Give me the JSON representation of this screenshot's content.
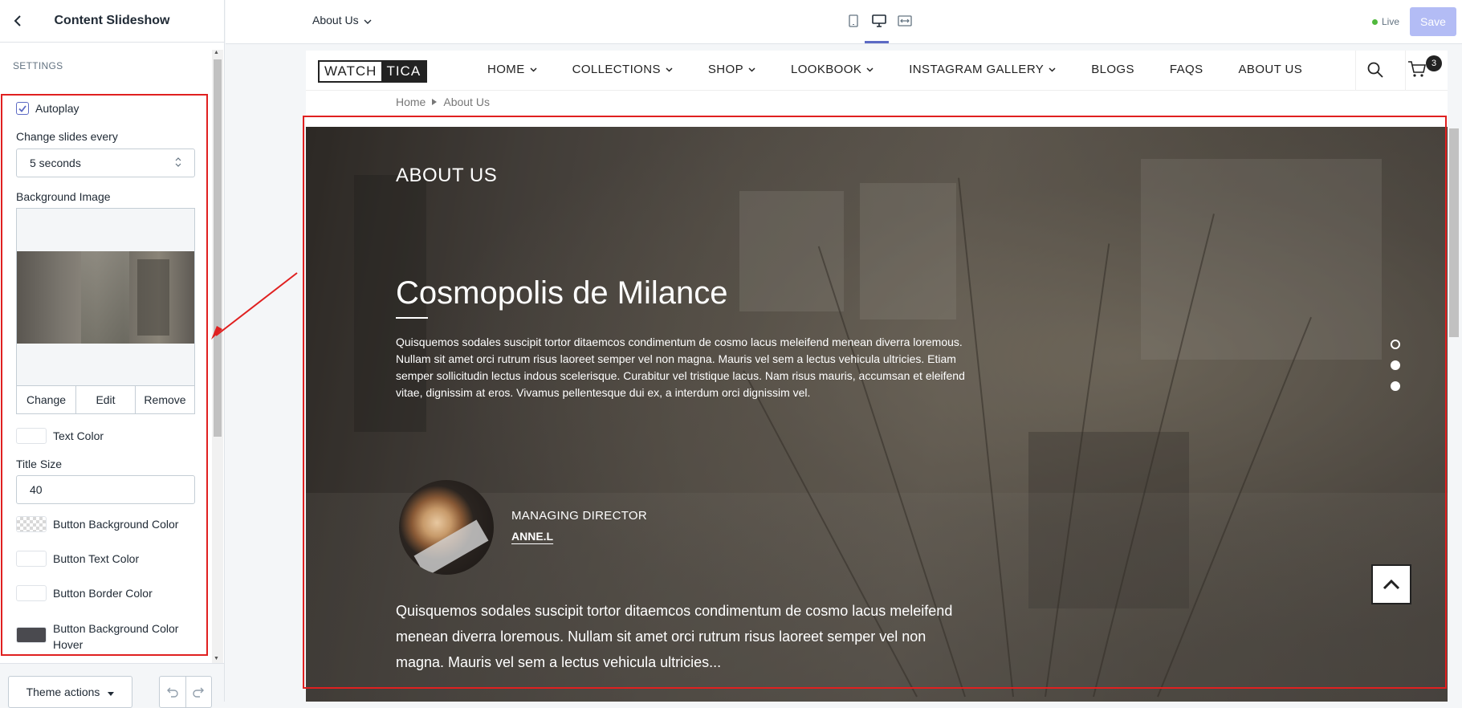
{
  "sidebar": {
    "title": "Content Slideshow",
    "section": "SETTINGS",
    "autoplay_label": "Autoplay",
    "autoplay_checked": true,
    "change_slides_label": "Change slides every",
    "change_slides_value": "5 seconds",
    "bg_image_label": "Background Image",
    "image_actions": [
      "Change",
      "Edit",
      "Remove"
    ],
    "text_color_label": "Text Color",
    "title_size_label": "Title Size",
    "title_size_value": "40",
    "btn_bg_color_label": "Button Background Color",
    "btn_text_color_label": "Button Text Color",
    "btn_border_color_label": "Button Border Color",
    "btn_bg_hover_label_line1": "Button Background Color",
    "btn_bg_hover_label_line2": "Hover",
    "theme_actions_label": "Theme actions"
  },
  "topbar": {
    "page_select": "About Us",
    "live_label": "Live",
    "save_label": "Save"
  },
  "site": {
    "logo_left": "WATCH",
    "logo_right": "TICA",
    "nav": [
      "HOME",
      "COLLECTIONS",
      "SHOP",
      "LOOKBOOK",
      "INSTAGRAM GALLERY",
      "BLOGS",
      "FAQS",
      "ABOUT US"
    ],
    "nav_has_dropdown": [
      true,
      true,
      true,
      true,
      true,
      false,
      false,
      false
    ],
    "cart_count": "3",
    "breadcrumb": [
      "Home",
      "About Us"
    ]
  },
  "hero": {
    "heading": "ABOUT US",
    "title": "Cosmopolis de Milance",
    "paragraph": "Quisquemos sodales suscipit tortor ditaemcos condimentum de cosmo lacus meleifend menean diverra loremous. Nullam sit amet orci rutrum risus laoreet semper vel non magna. Mauris vel sem a lectus vehicula ultricies. Etiam semper sollicitudin lectus indous scelerisque. Curabitur vel tristique lacus. Nam risus mauris, accumsan et eleifend vitae, dignissim at eros. Vivamus pellentesque dui ex, a interdum orci dignissim vel.",
    "role": "MANAGING DIRECTOR",
    "name": "ANNE.L",
    "quote": "Quisquemos sodales suscipit tortor ditaemcos condimentum de cosmo lacus meleifend menean diverra loremous. Nullam sit amet orci rutrum risus laoreet semper vel non magna. Mauris vel sem a lectus vehicula ultricies...",
    "active_dot": 1
  },
  "colors": {
    "annotation": "#e02020",
    "accent": "#5c6ac4",
    "save_disabled": "#b3bcf5",
    "live_dot": "#50b83c"
  }
}
